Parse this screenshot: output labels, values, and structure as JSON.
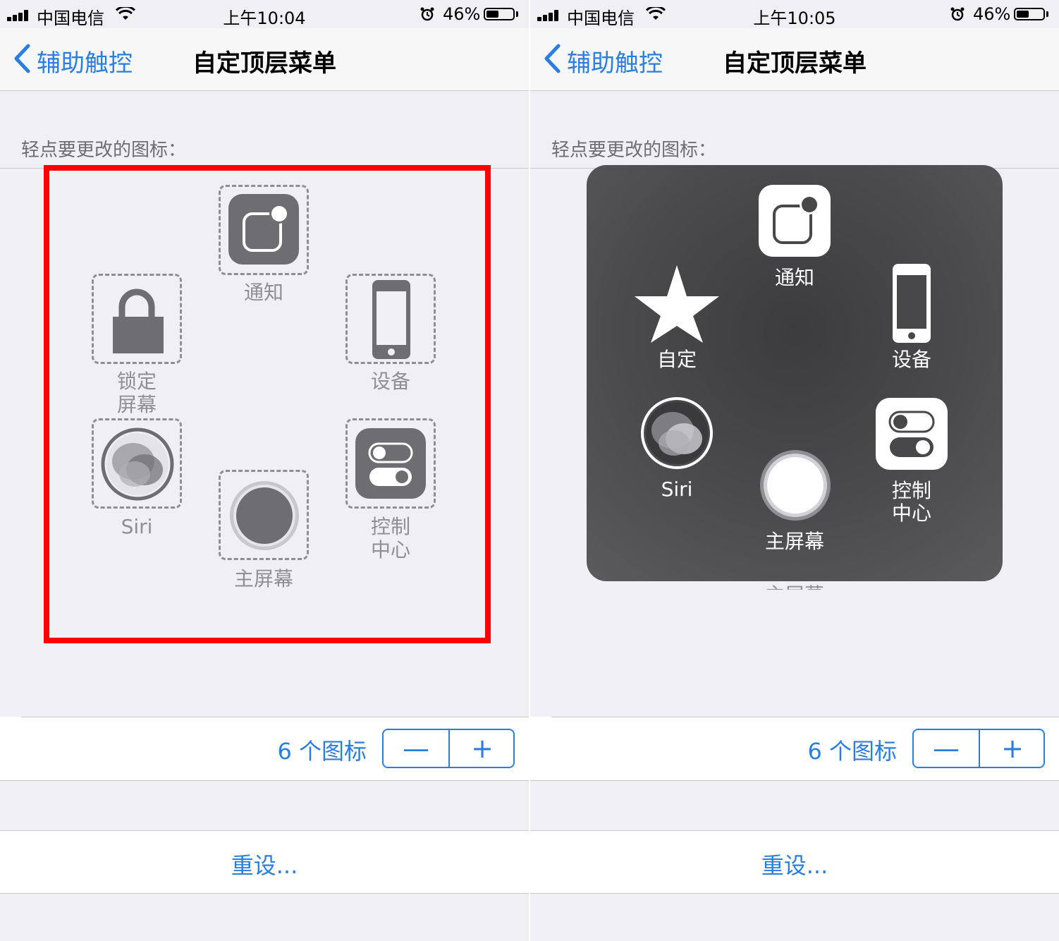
{
  "colors": {
    "accent": "#2a7ee0",
    "highlight": "#ff0000",
    "icon_gray": "#6e6e72",
    "panel": "#4a4a4c"
  },
  "screens": [
    {
      "status": {
        "carrier": "中国电信",
        "time": "上午10:04",
        "battery": "46%",
        "battery_level": 0.46
      },
      "nav": {
        "back_label": "辅助触控",
        "title": "自定顶层菜单"
      },
      "section_header": "轻点要更改的图标：",
      "icons": {
        "notify": "通知",
        "lock_line1": "锁定",
        "lock_line2": "屏幕",
        "device": "设备",
        "siri": "Siri",
        "control_line1": "控制",
        "control_line2": "中心",
        "home": "主屏幕"
      },
      "stepper": {
        "count_label": "6 个图标",
        "minus": "—",
        "plus": "+"
      },
      "reset_label": "重设..."
    },
    {
      "status": {
        "carrier": "中国电信",
        "time": "上午10:05",
        "battery": "46%",
        "battery_level": 0.46
      },
      "nav": {
        "back_label": "辅助触控",
        "title": "自定顶层菜单"
      },
      "section_header": "轻点要更改的图标：",
      "menu": {
        "notify": "通知",
        "custom": "自定",
        "device": "设备",
        "siri": "Siri",
        "home": "主屏幕",
        "control_line1": "控制",
        "control_line2": "中心"
      },
      "stepper": {
        "count_label": "6 个图标",
        "minus": "—",
        "plus": "+"
      },
      "reset_label": "重设..."
    }
  ]
}
